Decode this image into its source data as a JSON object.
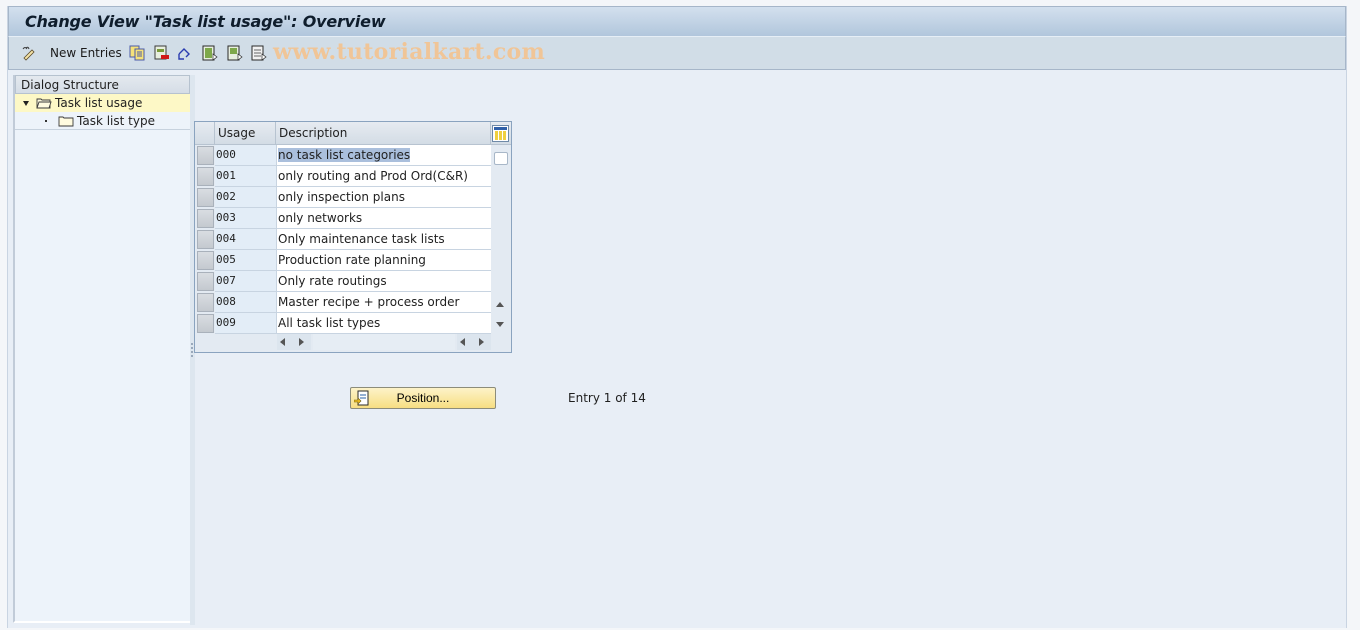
{
  "window": {
    "title": "Change View \"Task list usage\": Overview"
  },
  "toolbar": {
    "items": [
      {
        "icon": "edit-pencil-icon",
        "label": ""
      },
      {
        "icon": "new-entries",
        "label": "New Entries"
      },
      {
        "icon": "copy-icon",
        "label": ""
      },
      {
        "icon": "delete-icon",
        "label": ""
      },
      {
        "icon": "undo-change-icon",
        "label": ""
      },
      {
        "icon": "select-all-icon",
        "label": ""
      },
      {
        "icon": "select-block-icon",
        "label": ""
      },
      {
        "icon": "deselect-all-icon",
        "label": ""
      }
    ],
    "new_entries_label": "New Entries",
    "watermark": "www.tutorialkart.com"
  },
  "dialog_structure": {
    "header": "Dialog Structure",
    "items": [
      {
        "label": "Task list usage",
        "level": 0,
        "expanded": true,
        "selected": true,
        "icon": "open-folder-icon"
      },
      {
        "label": "Task list type",
        "level": 1,
        "selected": false,
        "icon": "folder-icon"
      }
    ]
  },
  "table": {
    "columns": [
      "Usage",
      "Description"
    ],
    "rows": [
      {
        "usage": "000",
        "description": "no task list categories",
        "highlighted": true
      },
      {
        "usage": "001",
        "description": "only routing and Prod Ord(C&R)"
      },
      {
        "usage": "002",
        "description": "only inspection plans"
      },
      {
        "usage": "003",
        "description": "only networks"
      },
      {
        "usage": "004",
        "description": "Only maintenance task lists"
      },
      {
        "usage": "005",
        "description": "Production rate planning"
      },
      {
        "usage": "007",
        "description": "Only rate routings"
      },
      {
        "usage": "008",
        "description": "Master recipe + process order"
      },
      {
        "usage": "009",
        "description": "All task list types"
      }
    ]
  },
  "footer": {
    "position_button": "Position...",
    "entry_info": "Entry 1 of 14"
  },
  "colors": {
    "title_gradient_top": "#d3e0ee",
    "toolbar_bg": "#d1dde7",
    "selected_tree_bg": "#fdf8c6",
    "cell_highlight": "#aabfdc",
    "button_yellow": "#f7de82",
    "watermark": "#f0c597"
  }
}
